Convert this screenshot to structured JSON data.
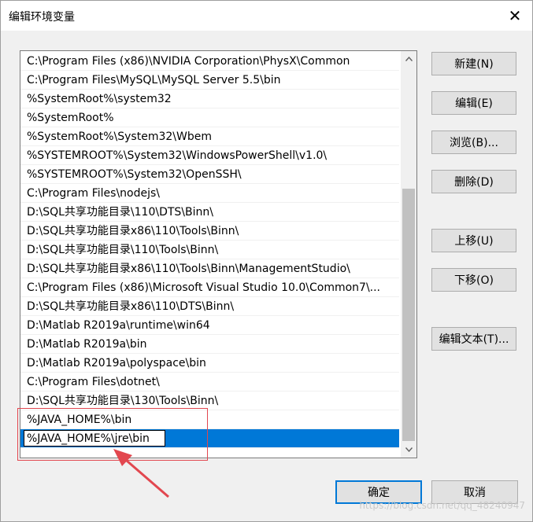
{
  "window": {
    "title": "编辑环境变量",
    "close_glyph": "✕"
  },
  "list": {
    "items": [
      "C:\\Program Files (x86)\\NVIDIA Corporation\\PhysX\\Common",
      "C:\\Program Files\\MySQL\\MySQL Server 5.5\\bin",
      "%SystemRoot%\\system32",
      "%SystemRoot%",
      "%SystemRoot%\\System32\\Wbem",
      "%SYSTEMROOT%\\System32\\WindowsPowerShell\\v1.0\\",
      "%SYSTEMROOT%\\System32\\OpenSSH\\",
      "C:\\Program Files\\nodejs\\",
      "D:\\SQL共享功能目录\\110\\DTS\\Binn\\",
      "D:\\SQL共享功能目录x86\\110\\Tools\\Binn\\",
      "D:\\SQL共享功能目录\\110\\Tools\\Binn\\",
      "D:\\SQL共享功能目录x86\\110\\Tools\\Binn\\ManagementStudio\\",
      "C:\\Program Files (x86)\\Microsoft Visual Studio 10.0\\Common7\\...",
      "D:\\SQL共享功能目录x86\\110\\DTS\\Binn\\",
      "D:\\Matlab R2019a\\runtime\\win64",
      "D:\\Matlab R2019a\\bin",
      "D:\\Matlab R2019a\\polyspace\\bin",
      "C:\\Program Files\\dotnet\\",
      "D:\\SQL共享功能目录\\130\\Tools\\Binn\\",
      "%JAVA_HOME%\\bin"
    ],
    "editing_value": "%JAVA_HOME%\\jre\\bin"
  },
  "buttons": {
    "new": "新建(N)",
    "edit": "编辑(E)",
    "browse": "浏览(B)...",
    "delete": "删除(D)",
    "move_up": "上移(U)",
    "move_down": "下移(O)",
    "edit_text": "编辑文本(T)...",
    "ok": "确定",
    "cancel": "取消"
  },
  "watermark": "https://blog.csdn.net/qq_48240947",
  "colors": {
    "selection": "#0078d7",
    "annotation": "#e2474f"
  }
}
